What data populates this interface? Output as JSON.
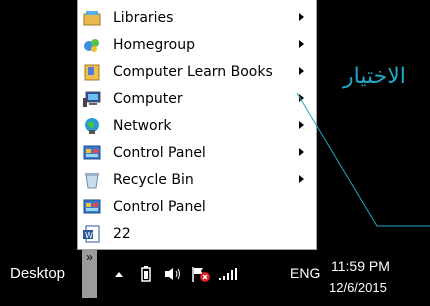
{
  "jumpmenu": {
    "items": [
      {
        "label": "Libraries",
        "icon": "libraries-icon",
        "submenu": true
      },
      {
        "label": "Homegroup",
        "icon": "homegroup-icon",
        "submenu": true
      },
      {
        "label": "Computer Learn Books",
        "icon": "folder-icon",
        "submenu": true
      },
      {
        "label": "Computer",
        "icon": "computer-icon",
        "submenu": true
      },
      {
        "label": "Network",
        "icon": "network-icon",
        "submenu": true
      },
      {
        "label": "Control Panel",
        "icon": "control-panel-icon",
        "submenu": true
      },
      {
        "label": "Recycle Bin",
        "icon": "recycle-bin-icon",
        "submenu": true
      },
      {
        "label": "Control Panel",
        "icon": "control-panel-icon",
        "submenu": false
      },
      {
        "label": "22",
        "icon": "word-document-icon",
        "submenu": false
      }
    ]
  },
  "annotation": {
    "text": "الاختيار",
    "color": "#21a8c9"
  },
  "taskbar": {
    "toolbar_label": "Desktop",
    "chevron": "»",
    "language": "ENG",
    "time": "11:59 PM",
    "date": "12/6/2015"
  },
  "colors": {
    "menu_bg": "#ffffff",
    "taskbar_bg": "#000000",
    "annotation": "#21a8c9"
  }
}
